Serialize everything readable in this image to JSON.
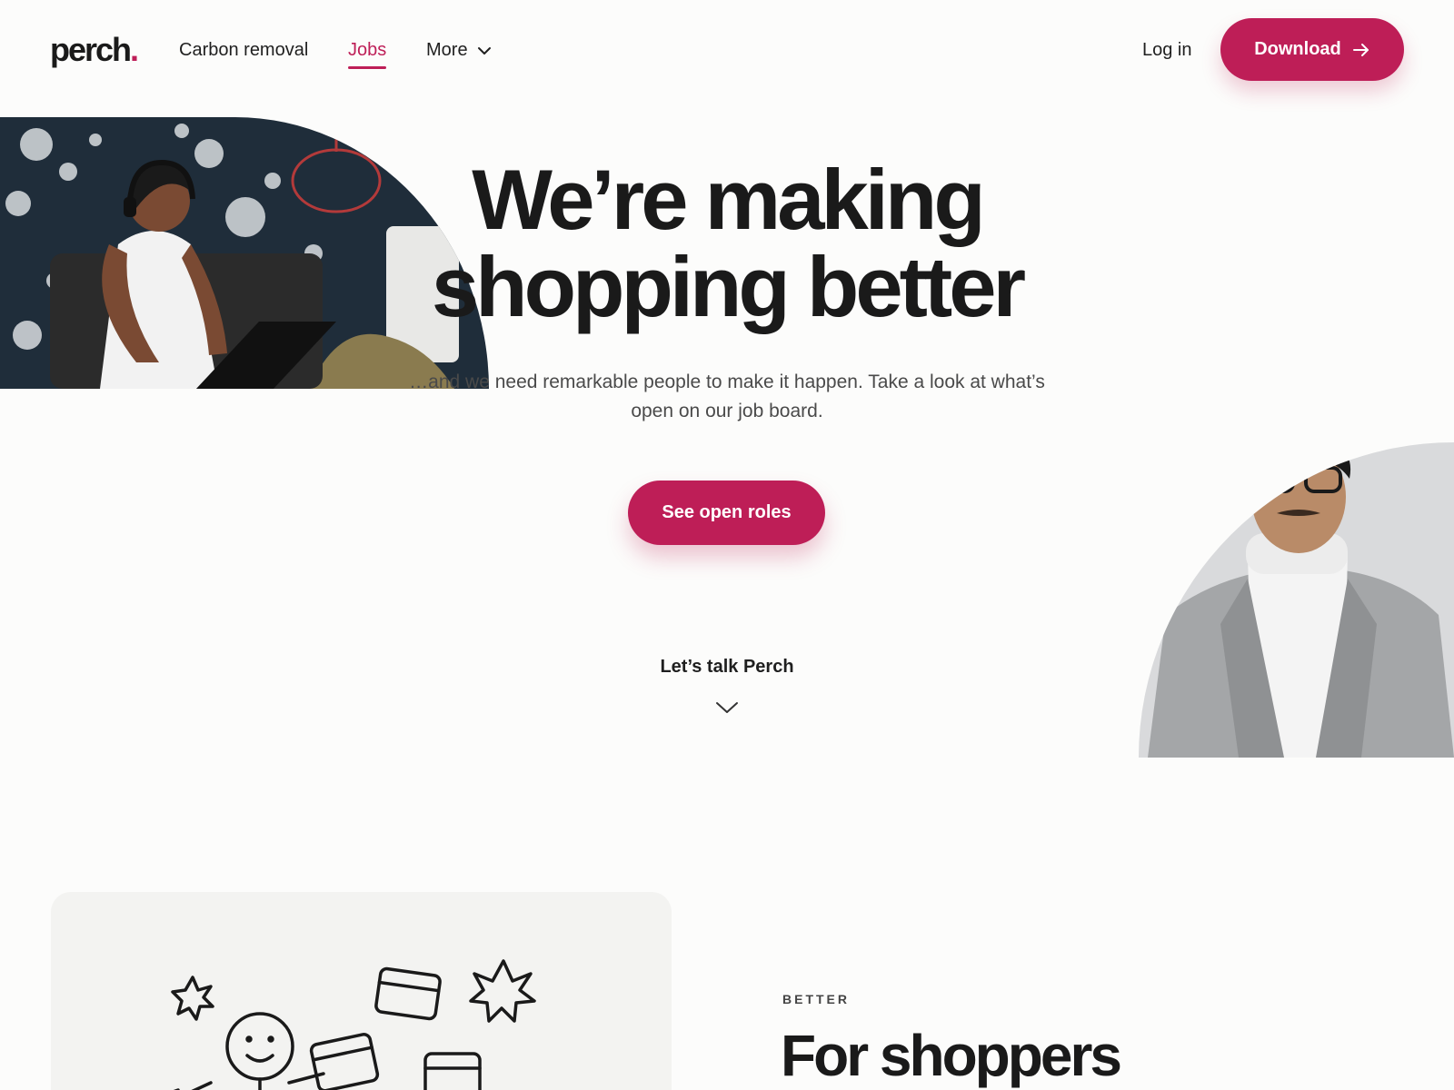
{
  "theme": {
    "accent": "#be1e57",
    "text": "#1a1a1a",
    "muted": "#4a4a4a",
    "background": "#fcfcfb"
  },
  "header": {
    "logo_text": "perch",
    "logo_dot": ".",
    "nav": [
      {
        "label": "Carbon removal",
        "active": false
      },
      {
        "label": "Jobs",
        "active": true
      },
      {
        "label": "More",
        "active": false,
        "icon": "chevron-down-icon"
      }
    ],
    "login_label": "Log in",
    "download_label": "Download",
    "download_icon": "arrow-right-icon"
  },
  "hero": {
    "title_line1": "We’re making",
    "title_line2": "shopping better",
    "subtitle": "…and we need remarkable people to make it happen. Take a look at what’s open on our job board.",
    "cta_label": "See open roles",
    "talk_label": "Let’s talk Perch",
    "talk_icon": "chevron-down-icon",
    "photo_left": "woman-with-headphones-laptop-photo",
    "photo_right": "man-in-grey-blazer-glasses-photo"
  },
  "section": {
    "eyebrow": "BETTER",
    "title": "For shoppers",
    "illustration": "shopper-with-cards-and-stars-illustration"
  }
}
